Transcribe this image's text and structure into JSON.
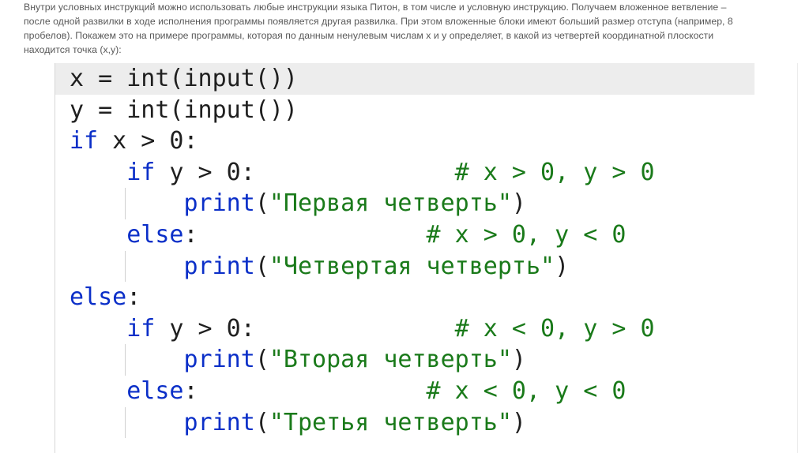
{
  "intro": {
    "lines": [
      "Внутри условных инструкций можно использовать любые инструкции языка Питон, в том числе и условную инструкцию. Получаем вложенное ветвление –",
      "после одной развилки в ходе исполнения программы появляется другая развилка. При этом вложенные блоки имеют больший размер отступа (например, 8",
      "пробелов). Покажем это на примере программы, которая по данным ненулевым числам x и y определяет, в какой из четвертей координатной плоскости",
      "находится точка (x,y):"
    ]
  },
  "code": {
    "lines": [
      {
        "indent": "",
        "tokens": [
          {
            "t": "x = int(input())",
            "c": "plain"
          }
        ]
      },
      {
        "indent": "",
        "tokens": [
          {
            "t": "y = int(input())",
            "c": "plain"
          }
        ]
      },
      {
        "indent": "",
        "tokens": [
          {
            "t": "if",
            "c": "kw"
          },
          {
            "t": " x > 0:",
            "c": "plain"
          }
        ]
      },
      {
        "indent": "    ",
        "tokens": [
          {
            "t": "if",
            "c": "kw"
          },
          {
            "t": " y > 0:",
            "c": "plain"
          },
          {
            "t": "              # x > 0, y > 0",
            "c": "cmt"
          }
        ]
      },
      {
        "indent": "        ",
        "tokens": [
          {
            "t": "print",
            "c": "fn"
          },
          {
            "t": "(",
            "c": "plain"
          },
          {
            "t": "\"Первая четверть\"",
            "c": "str"
          },
          {
            "t": ")",
            "c": "plain"
          }
        ]
      },
      {
        "indent": "    ",
        "tokens": [
          {
            "t": "else",
            "c": "kw"
          },
          {
            "t": ":",
            "c": "plain"
          },
          {
            "t": "                # x > 0, y < 0",
            "c": "cmt"
          }
        ]
      },
      {
        "indent": "        ",
        "tokens": [
          {
            "t": "print",
            "c": "fn"
          },
          {
            "t": "(",
            "c": "plain"
          },
          {
            "t": "\"Четвертая четверть\"",
            "c": "str"
          },
          {
            "t": ")",
            "c": "plain"
          }
        ]
      },
      {
        "indent": "",
        "tokens": [
          {
            "t": "else",
            "c": "kw"
          },
          {
            "t": ":",
            "c": "plain"
          }
        ]
      },
      {
        "indent": "    ",
        "tokens": [
          {
            "t": "if",
            "c": "kw"
          },
          {
            "t": " y > 0:",
            "c": "plain"
          },
          {
            "t": "              # x < 0, y > 0",
            "c": "cmt"
          }
        ]
      },
      {
        "indent": "        ",
        "tokens": [
          {
            "t": "print",
            "c": "fn"
          },
          {
            "t": "(",
            "c": "plain"
          },
          {
            "t": "\"Вторая четверть\"",
            "c": "str"
          },
          {
            "t": ")",
            "c": "plain"
          }
        ]
      },
      {
        "indent": "    ",
        "tokens": [
          {
            "t": "else",
            "c": "kw"
          },
          {
            "t": ":",
            "c": "plain"
          },
          {
            "t": "                # x < 0, y < 0",
            "c": "cmt"
          }
        ]
      },
      {
        "indent": "        ",
        "tokens": [
          {
            "t": "print",
            "c": "fn"
          },
          {
            "t": "(",
            "c": "plain"
          },
          {
            "t": "\"Третья четверть\"",
            "c": "str"
          },
          {
            "t": ")",
            "c": "plain"
          }
        ]
      }
    ],
    "highlighted_line": 0
  },
  "colors": {
    "keyword": "#0b2fc8",
    "string": "#1a7a1a",
    "comment": "#1a7a1a",
    "text": "#1f1f1f",
    "highlight": "#ededed"
  }
}
